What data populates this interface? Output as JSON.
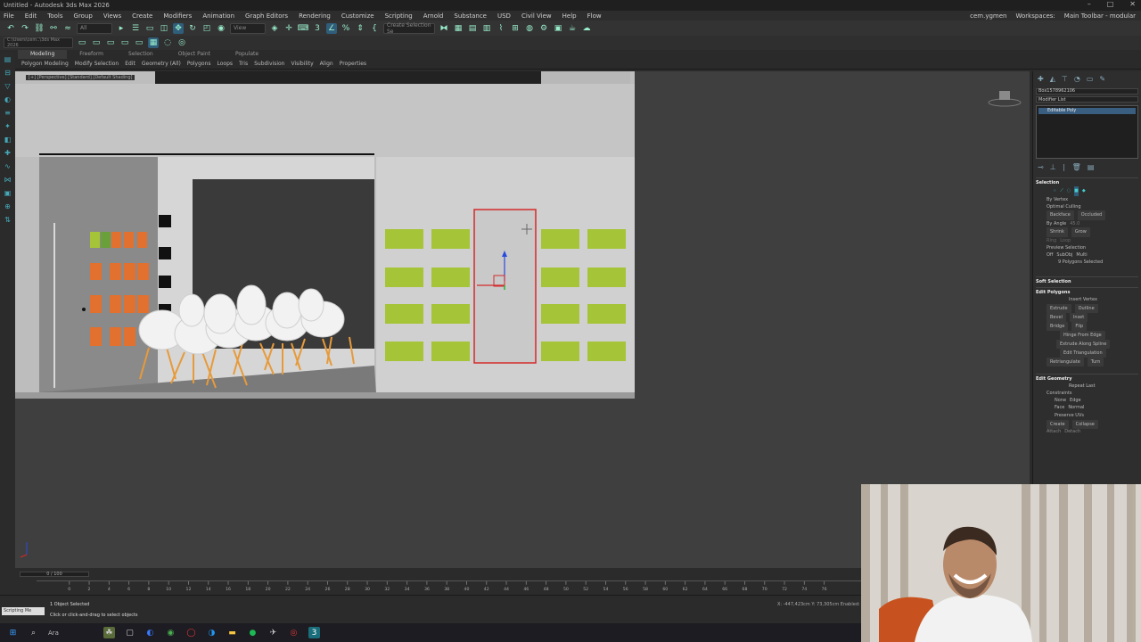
{
  "window": {
    "title": "Untitled - Autodesk 3ds Max 2026",
    "controls": [
      "–",
      "□",
      "✕"
    ]
  },
  "menu": {
    "items": [
      "File",
      "Edit",
      "Tools",
      "Group",
      "Views",
      "Create",
      "Modifiers",
      "Animation",
      "Graph Editors",
      "Rendering",
      "Customize",
      "Scripting",
      "Arnold",
      "Substance",
      "USD",
      "Civil View",
      "Help",
      "Flow"
    ],
    "user": "cem.ygmen",
    "workspaces_label": "Workspaces:",
    "workspace": "Main Toolbar - modular"
  },
  "toolbar": {
    "selection_filter": "All",
    "ref_coord": "View",
    "named_selection": "Create Selection Se"
  },
  "toolbar2": {
    "path": "C:\\Users\\cem..\\3ds Max 2026"
  },
  "ribbon": {
    "tabs": [
      "Modeling",
      "Freeform",
      "Selection",
      "Object Paint",
      "Populate"
    ],
    "active_tab": "Modeling",
    "subitems": [
      "Polygon Modeling",
      "Modify Selection",
      "Edit",
      "Geometry (All)",
      "Polygons",
      "Loops",
      "Tris",
      "Subdivision",
      "Visibility",
      "Align",
      "Properties"
    ]
  },
  "viewport": {
    "label": "[+] [Perspective] [Standard] [Default Shading]"
  },
  "command_panel": {
    "object_name": "Box1578962106",
    "modifier_list": "Modifier List",
    "stack_item": "Editable Poly",
    "selection": {
      "title": "Selection",
      "by_vertex": "By Vertex",
      "ignore_culling": "Optimal Culling",
      "backface": "Backface",
      "occluded": "Occluded",
      "by_angle": "By Angle",
      "angle_value": "45.0",
      "shrink": "Shrink",
      "grow": "Grow",
      "ring": "Ring",
      "loop": "Loop",
      "preview_selection": "Preview Selection",
      "preview_opts": [
        "Off",
        "SubObj",
        "Multi"
      ],
      "status": "9 Polygons Selected"
    },
    "soft_selection": "Soft Selection",
    "edit_polygons": {
      "title": "Edit Polygons",
      "insert_vertex": "Insert Vertex",
      "extrude": "Extrude",
      "outline": "Outline",
      "bevel": "Bevel",
      "inset": "Inset",
      "bridge": "Bridge",
      "flip": "Flip",
      "hinge": "Hinge From Edge",
      "extrude_spline": "Extrude Along Spline",
      "edit_tri": "Edit Triangulation",
      "retriangulate": "Retriangulate",
      "turn": "Turn"
    },
    "edit_geometry": {
      "title": "Edit Geometry",
      "repeat_last": "Repeat Last",
      "constraints": "Constraints",
      "c_none": "None",
      "c_edge": "Edge",
      "c_face": "Face",
      "c_normal": "Normal",
      "preserve_uvs": "Preserve UVs",
      "create": "Create",
      "collapse": "Collapse",
      "attach": "Attach",
      "detach": "Detach"
    }
  },
  "timeline": {
    "frame_display": "0 / 100",
    "tick_labels": [
      "0",
      "2",
      "4",
      "6",
      "8",
      "10",
      "12",
      "14",
      "16",
      "18",
      "20",
      "22",
      "24",
      "26",
      "28",
      "30",
      "32",
      "34",
      "36",
      "38",
      "40",
      "42",
      "44",
      "46",
      "48",
      "50",
      "52",
      "54",
      "56",
      "58",
      "60",
      "62",
      "64",
      "66",
      "68",
      "70",
      "72",
      "74",
      "76"
    ]
  },
  "status": {
    "maxscript": "Scripting Me",
    "selected": "1 Object Selected",
    "prompt": "Click or click-and-drag to select objects",
    "x": "X: -447,423cm",
    "y": "Y: 73,305cm",
    "enabled": "Enabled:"
  },
  "taskbar": {
    "search": "Ara"
  },
  "colors": {
    "viewport_bg": "#3f3f3f",
    "green_panel": "#a6c437",
    "orange_panel": "#e2702e",
    "selection_red": "#d42a2a",
    "active_blue": "#2f5d7a"
  }
}
